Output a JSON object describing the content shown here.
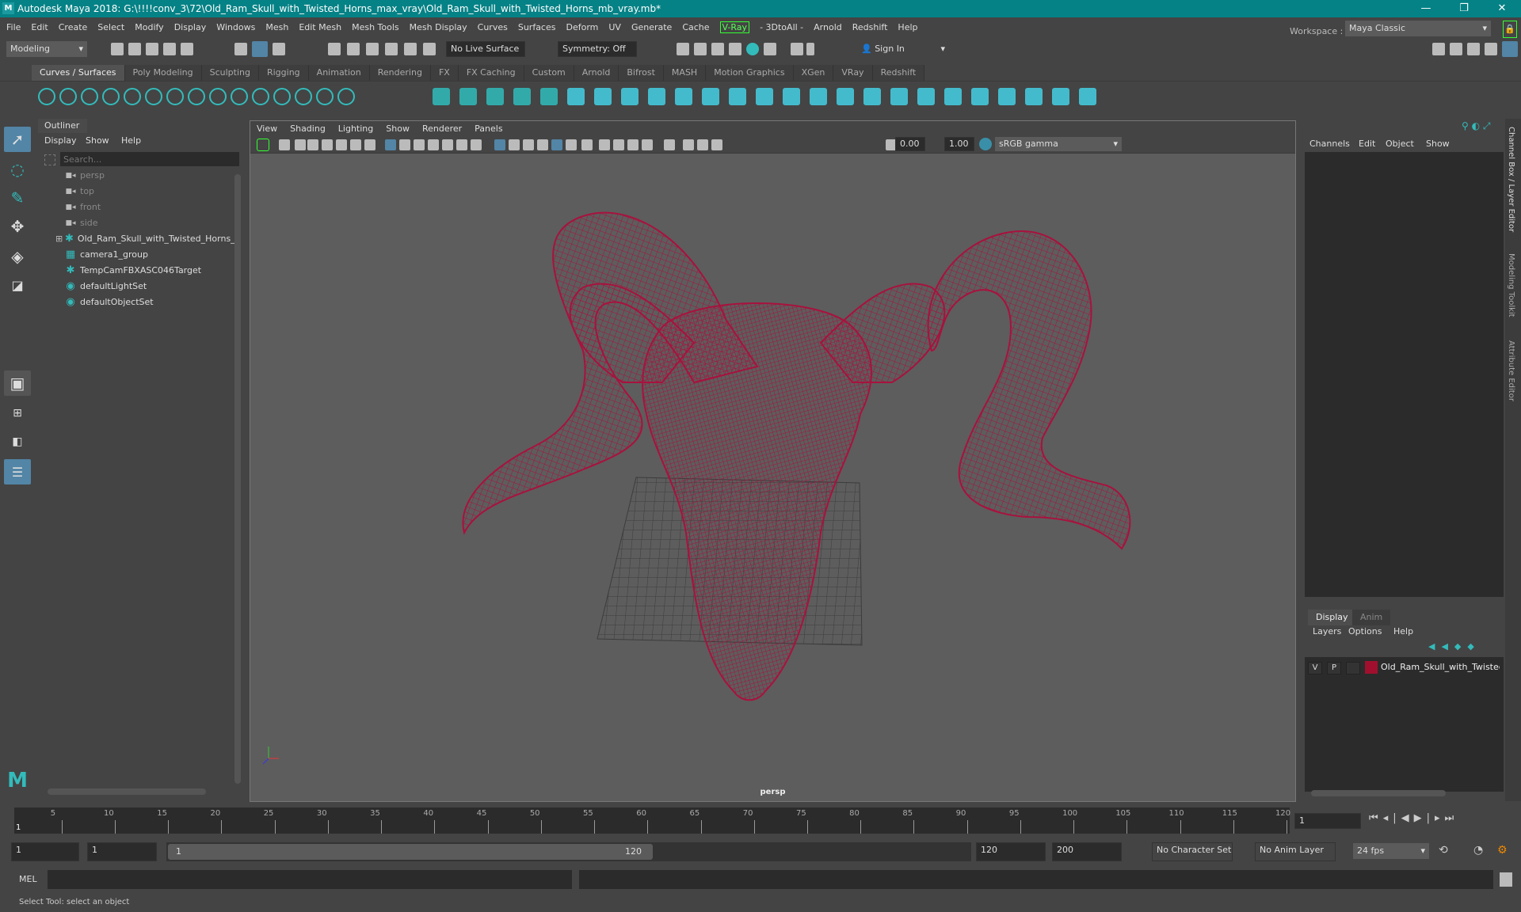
{
  "window": {
    "title": "Autodesk Maya 2018: G:\\!!!!conv_3\\72\\Old_Ram_Skull_with_Twisted_Horns_max_vray\\Old_Ram_Skull_with_Twisted_Horns_mb_vray.mb*",
    "minimize": "—",
    "maximize": "❐",
    "close": "✕"
  },
  "menu": [
    "File",
    "Edit",
    "Create",
    "Select",
    "Modify",
    "Display",
    "Windows",
    "Mesh",
    "Edit Mesh",
    "Mesh Tools",
    "Mesh Display",
    "Curves",
    "Surfaces",
    "Deform",
    "UV",
    "Generate",
    "Cache",
    "V-Ray",
    "- 3DtoAll -",
    "Arnold",
    "Redshift",
    "Help"
  ],
  "toolbar": {
    "mode": "Modeling",
    "live_surface": "No Live Surface",
    "symmetry": "Symmetry: Off",
    "sign_in": "Sign In",
    "workspace_label": "Workspace :",
    "workspace": "Maya Classic"
  },
  "shelf_tabs": [
    "Curves / Surfaces",
    "Poly Modeling",
    "Sculpting",
    "Rigging",
    "Animation",
    "Rendering",
    "FX",
    "FX Caching",
    "Custom",
    "Arnold",
    "Bifrost",
    "MASH",
    "Motion Graphics",
    "XGen",
    "VRay",
    "Redshift"
  ],
  "outliner": {
    "title": "Outliner",
    "menu": [
      "Display",
      "Show",
      "Help"
    ],
    "search_placeholder": "Search...",
    "items": [
      {
        "label": "persp",
        "type": "camera"
      },
      {
        "label": "top",
        "type": "camera"
      },
      {
        "label": "front",
        "type": "camera"
      },
      {
        "label": "side",
        "type": "camera"
      },
      {
        "label": "Old_Ram_Skull_with_Twisted_Horns_",
        "type": "transform"
      },
      {
        "label": "camera1_group",
        "type": "group"
      },
      {
        "label": "TempCamFBXASC046Target",
        "type": "transform"
      },
      {
        "label": "defaultLightSet",
        "type": "set"
      },
      {
        "label": "defaultObjectSet",
        "type": "set"
      }
    ]
  },
  "viewport": {
    "menu": [
      "View",
      "Shading",
      "Lighting",
      "Show",
      "Renderer",
      "Panels"
    ],
    "exposure": "0.00",
    "gamma": "1.00",
    "color_space": "sRGB gamma",
    "camera": "persp",
    "wire_color": "#a8123e"
  },
  "channel_box": {
    "menu": [
      "Channels",
      "Edit",
      "Object",
      "Show"
    ],
    "layer_tabs": [
      "Display",
      "Anim"
    ],
    "layer_menu": [
      "Layers",
      "Options",
      "Help"
    ],
    "layer": {
      "v": "V",
      "p": "P",
      "name": "Old_Ram_Skull_with_Twisted_Horns",
      "color": "#a0102e"
    }
  },
  "side_tabs": [
    "Channel Box / Layer Editor",
    "Modeling Toolkit",
    "Attribute Editor"
  ],
  "timeline": {
    "ticks": [
      "5",
      "10",
      "15",
      "20",
      "25",
      "30",
      "35",
      "40",
      "45",
      "50",
      "55",
      "60",
      "65",
      "70",
      "75",
      "80",
      "85",
      "90",
      "95",
      "100",
      "105",
      "110",
      "115",
      "120"
    ],
    "current": "1",
    "current_field": "1"
  },
  "range": {
    "start": "1",
    "playback_start": "1",
    "slider_start": "1",
    "slider_end": "120",
    "playback_end": "120",
    "end": "200",
    "character_set": "No Character Set",
    "anim_layer": "No Anim Layer",
    "fps": "24 fps"
  },
  "mel": {
    "label": "MEL"
  },
  "status": "Select Tool: select an object"
}
